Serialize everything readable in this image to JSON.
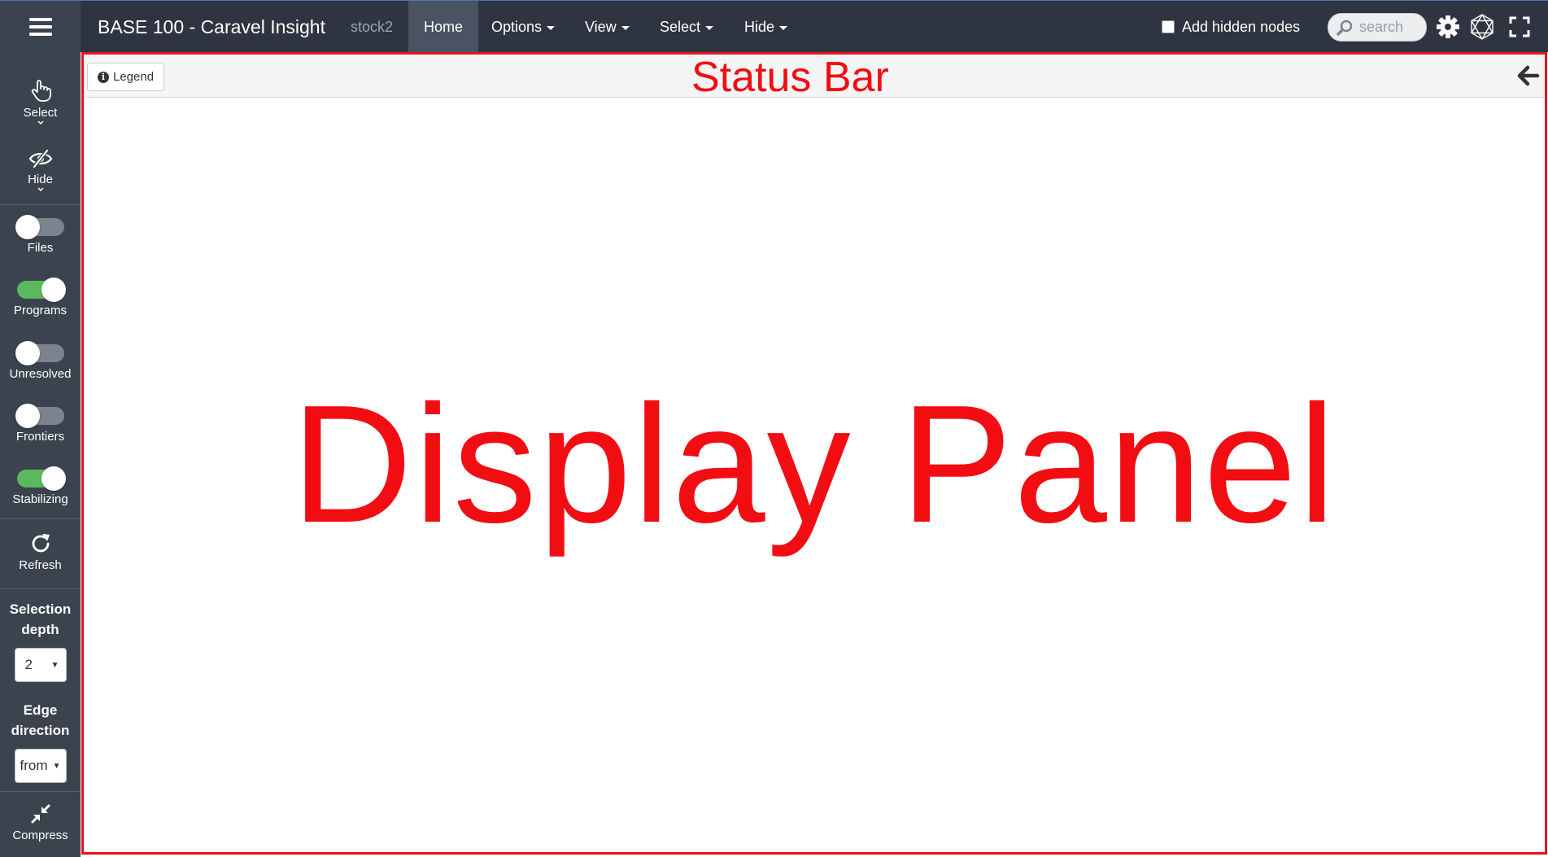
{
  "navbar": {
    "brand": "BASE 100 - Caravel Insight",
    "project": "stock2",
    "items": [
      {
        "label": "Home",
        "active": true
      },
      {
        "label": "Options",
        "dropdown": true
      },
      {
        "label": "View",
        "dropdown": true
      },
      {
        "label": "Select",
        "dropdown": true
      },
      {
        "label": "Hide",
        "dropdown": true
      }
    ],
    "add_hidden_nodes_label": "Add hidden nodes",
    "add_hidden_nodes_checked": false,
    "search_placeholder": "search",
    "icons": [
      "menu-icon",
      "search-icon",
      "gear-icon",
      "network-icon",
      "fullscreen-icon"
    ]
  },
  "sidebar": {
    "select_label": "Select",
    "hide_label": "Hide",
    "toggles": [
      {
        "label": "Files",
        "on": false
      },
      {
        "label": "Programs",
        "on": true
      },
      {
        "label": "Unresolved",
        "on": false
      },
      {
        "label": "Frontiers",
        "on": false
      },
      {
        "label": "Stabilizing",
        "on": true
      }
    ],
    "refresh_label": "Refresh",
    "selection_depth_label_1": "Selection",
    "selection_depth_label_2": "depth",
    "selection_depth_value": "2",
    "edge_direction_label_1": "Edge",
    "edge_direction_label_2": "direction",
    "edge_direction_value": "from",
    "compress_label": "Compress",
    "icons": [
      "hand-pointer-icon",
      "eye-slash-icon",
      "refresh-icon",
      "compress-icon",
      "chevron-down-icon"
    ]
  },
  "status_bar": {
    "legend_label": "Legend",
    "annotation": "Status Bar"
  },
  "display_panel": {
    "annotation": "Display Panel"
  },
  "colors": {
    "navbar_bg": "#2f3540",
    "sidebar_bg": "#3b434f",
    "active_tab_bg": "#4a5361",
    "toggle_on": "#5cb85c",
    "toggle_off": "#7c838c",
    "annotation_red": "#f20d13"
  }
}
